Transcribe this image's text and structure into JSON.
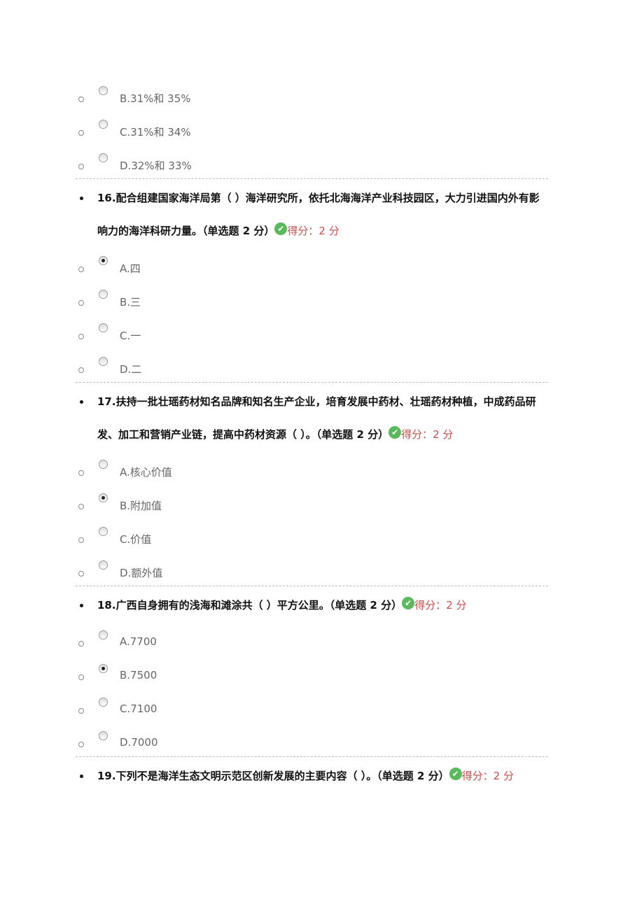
{
  "blocks": [
    {
      "options": [
        {
          "label": "B.31%和 35%",
          "selected": false
        },
        {
          "label": "C.31%和 34%",
          "selected": false
        },
        {
          "label": "D.32%和 33%",
          "selected": false
        }
      ]
    },
    {
      "question": "16.配合组建国家海洋局第（ ）海洋研究所，依托北海海洋产业科技园区，大力引进国内外有影响力的海洋科研力量。（单选题 2 分）",
      "score": "得分：2 分",
      "options": [
        {
          "label": "A.四",
          "selected": true
        },
        {
          "label": "B.三",
          "selected": false
        },
        {
          "label": "C.一",
          "selected": false
        },
        {
          "label": "D.二",
          "selected": false
        }
      ]
    },
    {
      "question": "17.扶持一批壮瑶药材知名品牌和知名生产企业，培育发展中药材、壮瑶药材种植，中成药品研发、加工和营销产业链，提高中药材资源（ ）。（单选题 2 分）",
      "score": "得分：2 分",
      "options": [
        {
          "label": "A.核心价值",
          "selected": false
        },
        {
          "label": "B.附加值",
          "selected": true
        },
        {
          "label": "C.价值",
          "selected": false
        },
        {
          "label": "D.额外值",
          "selected": false
        }
      ]
    },
    {
      "question": "18.广西自身拥有的浅海和滩涂共（ ）平方公里。（单选题 2 分）",
      "score": "得分：2 分",
      "options": [
        {
          "label": "A.7700",
          "selected": false
        },
        {
          "label": "B.7500",
          "selected": true
        },
        {
          "label": "C.7100",
          "selected": false
        },
        {
          "label": "D.7000",
          "selected": false
        }
      ]
    },
    {
      "question": "19.下列不是海洋生态文明示范区创新发展的主要内容（ ）。（单选题 2 分）",
      "score": "得分：2 分",
      "options": []
    }
  ],
  "colors": {
    "score": "#c0504d",
    "check": "#5cb85c"
  },
  "icons": {
    "correct": "check-circle-icon"
  }
}
